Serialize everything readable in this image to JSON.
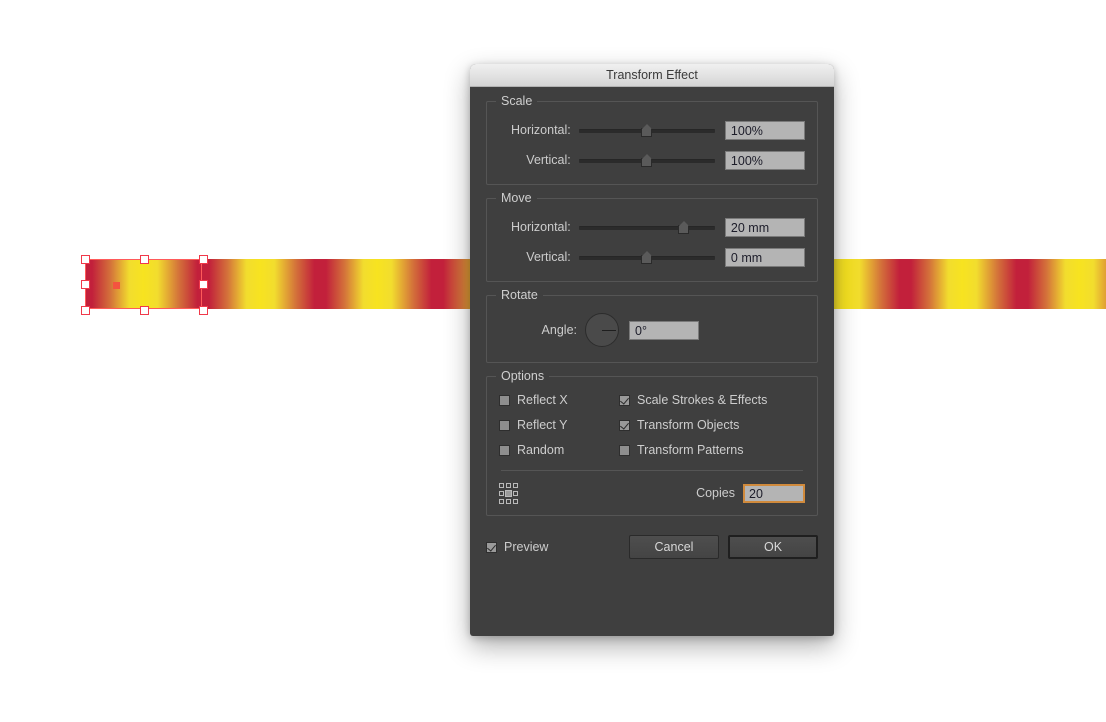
{
  "canvas": {
    "artwork_name": "gradient-stripe-pattern",
    "stripe_colors": [
      "#c2203b",
      "#d4733a",
      "#f7e320"
    ],
    "selection_color": "#f0394a"
  },
  "dialog": {
    "title": "Transform Effect",
    "scale": {
      "legend": "Scale",
      "horizontal_label": "Horizontal:",
      "horizontal_value": "100%",
      "horizontal_slider_pct": 50,
      "vertical_label": "Vertical:",
      "vertical_value": "100%",
      "vertical_slider_pct": 50
    },
    "move": {
      "legend": "Move",
      "horizontal_label": "Horizontal:",
      "horizontal_value": "20 mm",
      "horizontal_slider_pct": 77,
      "vertical_label": "Vertical:",
      "vertical_value": "0 mm",
      "vertical_slider_pct": 50
    },
    "rotate": {
      "legend": "Rotate",
      "angle_label": "Angle:",
      "angle_value": "0°",
      "angle_degrees": 0
    },
    "options": {
      "legend": "Options",
      "reflect_x": {
        "label": "Reflect X",
        "checked": false
      },
      "reflect_y": {
        "label": "Reflect Y",
        "checked": false
      },
      "random": {
        "label": "Random",
        "checked": false
      },
      "scale_strokes": {
        "label": "Scale Strokes & Effects",
        "checked": true
      },
      "transform_objects": {
        "label": "Transform Objects",
        "checked": true
      },
      "transform_patterns": {
        "label": "Transform Patterns",
        "checked": false
      },
      "copies_label": "Copies",
      "copies_value": "20",
      "copies_field_accent": "#d08a3c",
      "reference_point": "center"
    },
    "footer": {
      "preview_label": "Preview",
      "preview_checked": true,
      "cancel_label": "Cancel",
      "ok_label": "OK"
    }
  }
}
